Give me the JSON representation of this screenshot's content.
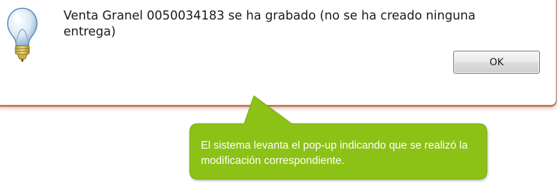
{
  "dialog": {
    "message": "Venta Granel 0050034183 se ha grabado (no se ha creado ninguna entrega)",
    "ok_label": "OK",
    "icon": "lightbulb-icon"
  },
  "callout": {
    "text": "El sistema levanta el pop-up indicando que se realizó la modificación correspondiente.",
    "color": "#8cc113"
  }
}
